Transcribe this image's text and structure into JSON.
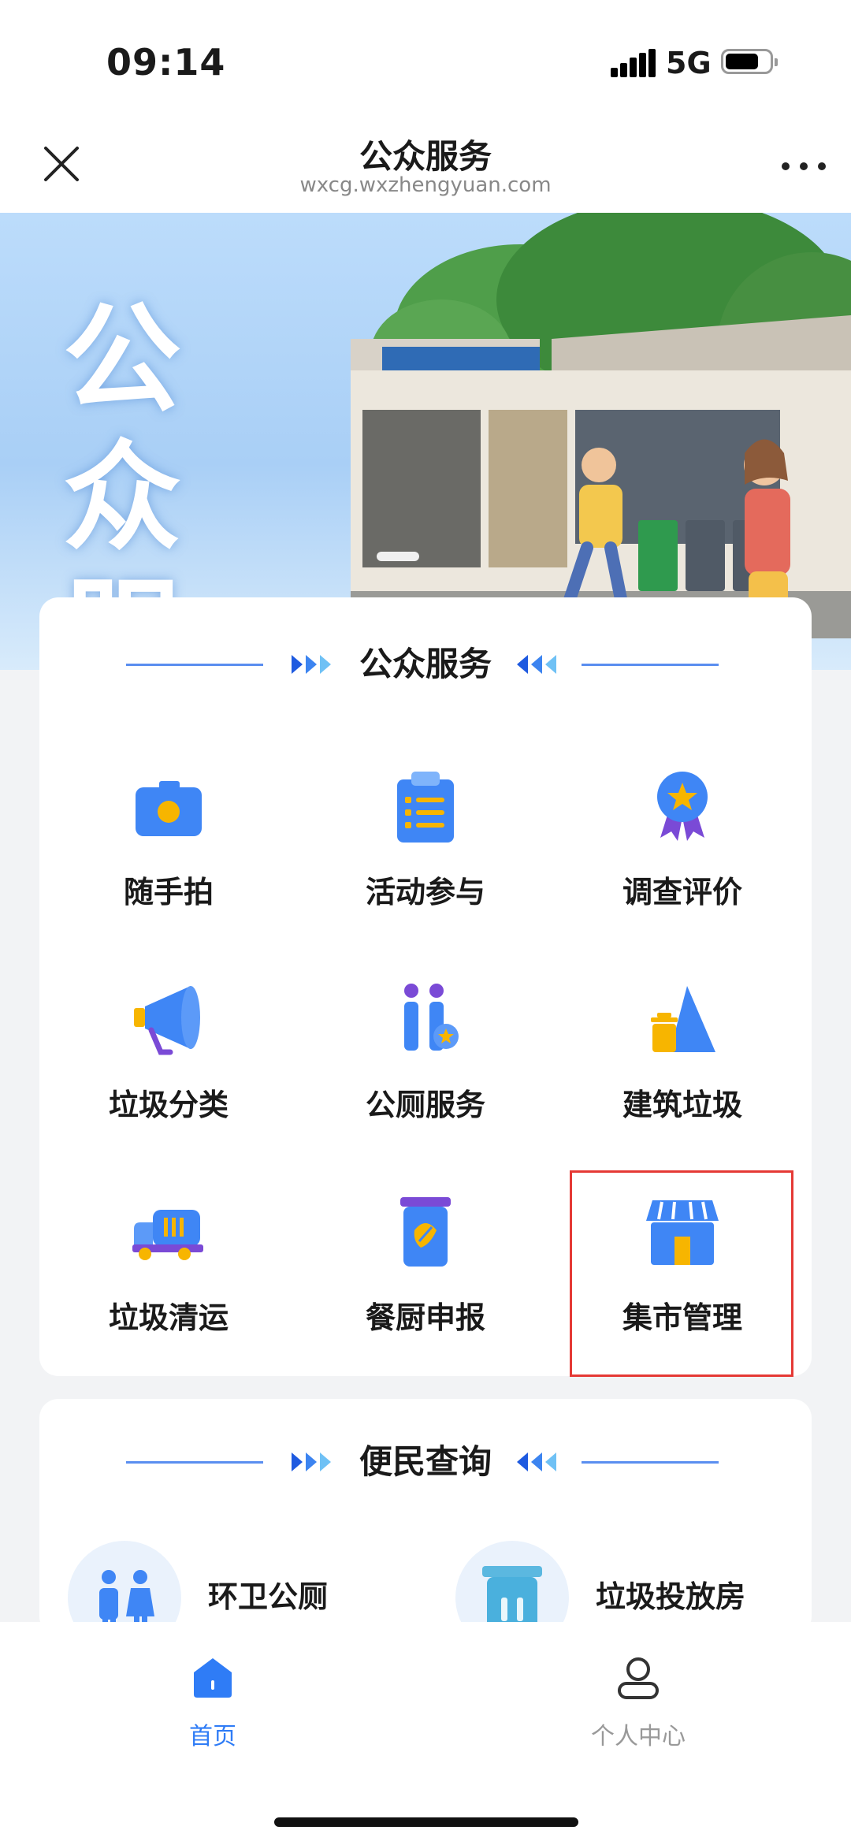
{
  "status_bar": {
    "time": "09:14",
    "network": "5G",
    "battery_level": 0.75
  },
  "nav": {
    "title": "公众服务",
    "url": "wxcg.wxzhengyuan.com",
    "close_icon": "close-icon",
    "more_icon": "more-icon"
  },
  "banner": {
    "title": "公众服务",
    "slide_count_visible": 1
  },
  "public_services": {
    "title": "公众服务",
    "items": [
      {
        "label": "随手拍",
        "icon": "camera-icon"
      },
      {
        "label": "活动参与",
        "icon": "clipboard-list-icon"
      },
      {
        "label": "调查评价",
        "icon": "award-medal-icon"
      },
      {
        "label": "垃圾分类",
        "icon": "megaphone-icon"
      },
      {
        "label": "公厕服务",
        "icon": "restroom-icon"
      },
      {
        "label": "建筑垃圾",
        "icon": "construction-waste-icon"
      },
      {
        "label": "垃圾清运",
        "icon": "garbage-truck-icon"
      },
      {
        "label": "餐厨申报",
        "icon": "kitchen-waste-bin-icon"
      },
      {
        "label": "集市管理",
        "icon": "market-stall-icon"
      }
    ]
  },
  "convenience_query": {
    "title": "便民查询",
    "items": [
      {
        "label": "环卫公厕",
        "icon": "toilet-people-icon"
      },
      {
        "label": "垃圾投放房",
        "icon": "trash-bin-icon"
      }
    ]
  },
  "tabbar": {
    "tabs": [
      {
        "label": "首页",
        "icon": "home-icon",
        "active": true
      },
      {
        "label": "个人中心",
        "icon": "user-icon",
        "active": false
      }
    ]
  },
  "colors": {
    "accent": "#3f86f5",
    "highlight_border": "#e53935",
    "active_tab": "#2f7cf6",
    "inactive_tab": "#999999"
  }
}
